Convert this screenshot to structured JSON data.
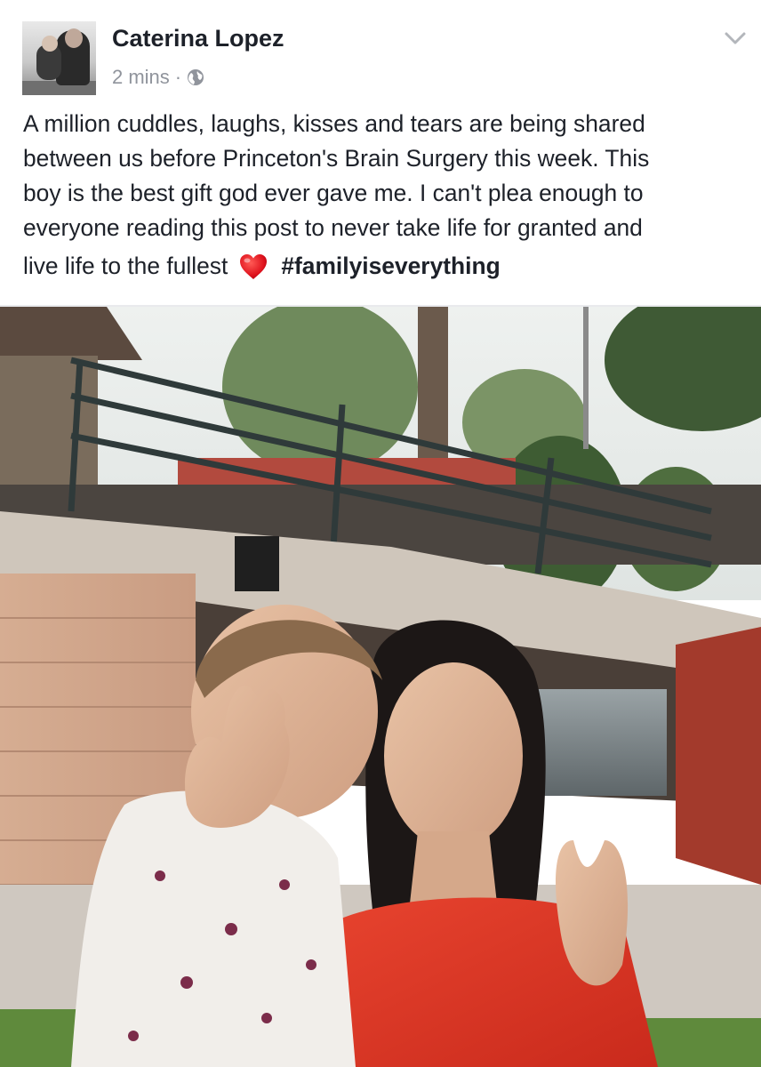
{
  "post": {
    "author": "Caterina Lopez",
    "timestamp": "2 mins",
    "separator": "·",
    "privacy_icon": "globe-icon",
    "menu_icon": "chevron-down-icon",
    "text_lines": [
      "A million cuddles, laughs, kisses and tears are being shared",
      "between us before Princeton's Brain Surgery this week. This",
      "boy is the best gift god ever gave me. I can't plea enough to",
      "everyone reading this post to never take life for granted and"
    ],
    "last_line_text": "live life to the fullest",
    "emoji": "heart-icon",
    "hashtag": "#familyiseverything"
  },
  "colors": {
    "text": "#1d2129",
    "meta": "#90949c",
    "heart": "#e0141e",
    "divider": "#e9eaed"
  }
}
